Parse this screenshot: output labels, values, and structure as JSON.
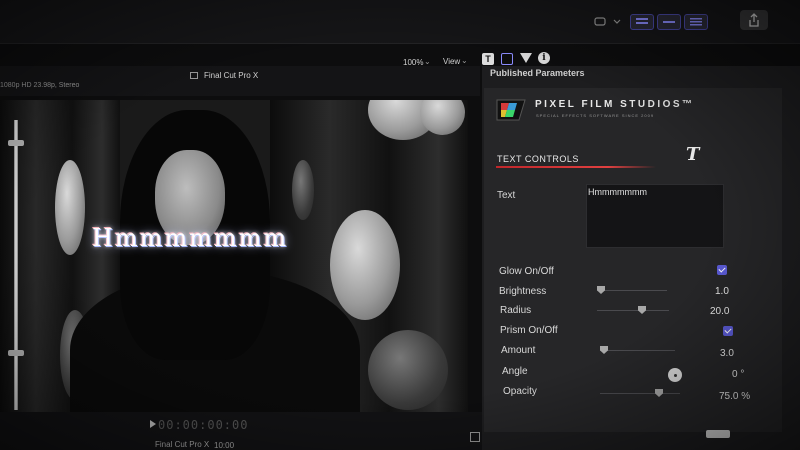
{
  "toolbar": {
    "zoom_label": "100%",
    "view_label": "View",
    "share_icon": "share-icon",
    "dropdown_icon": "keyword-dropdown-icon"
  },
  "viewer": {
    "format_label": "1080p HD 23.98p, Stereo",
    "title": "Final Cut Pro X",
    "overlay_text": "Hmmmmmmm"
  },
  "transport": {
    "timecode": "00:00:00:00",
    "project_label": "Final Cut Pro X",
    "duration": "10:00"
  },
  "inspector": {
    "header": "Published Parameters",
    "brand_name": "PIXEL FILM STUDIOS™",
    "brand_tagline": "SPECIAL EFFECTS SOFTWARE SINCE 2009",
    "section": "TEXT CONTROLS",
    "text_label": "Text",
    "text_value": "Hmmmmmmm",
    "params": [
      {
        "label": "Glow On/Off",
        "type": "checkbox",
        "checked": true
      },
      {
        "label": "Brightness",
        "type": "slider",
        "value": "1.0"
      },
      {
        "label": "Radius",
        "type": "slider",
        "value": "20.0"
      },
      {
        "label": "Prism On/Off",
        "type": "checkbox",
        "checked": true
      },
      {
        "label": "Amount",
        "type": "slider",
        "value": "3.0"
      },
      {
        "label": "Angle",
        "type": "dial",
        "value": "0 °"
      },
      {
        "label": "Opacity",
        "type": "slider",
        "value": "75.0 %"
      }
    ]
  },
  "colors": {
    "accent": "#5b5bd6",
    "section_rule": "#c0262a",
    "panel_bg": "#262628"
  }
}
